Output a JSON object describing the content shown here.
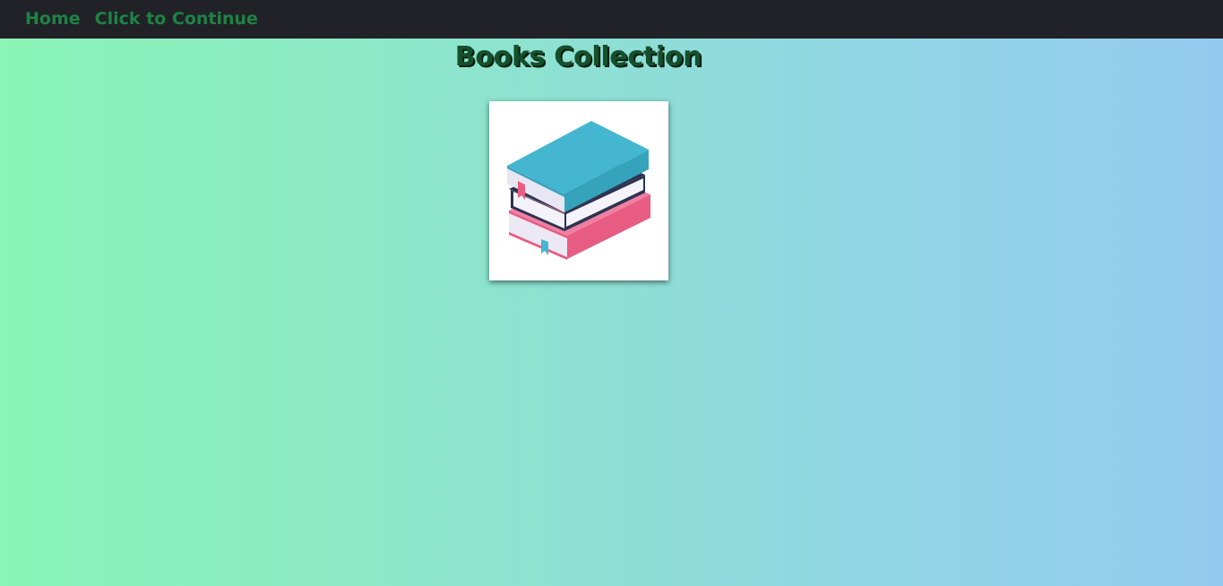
{
  "nav": {
    "home_label": "Home",
    "continue_label": "Click to Continue"
  },
  "main": {
    "title": "Books Collection"
  },
  "image": {
    "icon": "books-stack-icon"
  },
  "colors": {
    "nav_bg": "#202228",
    "nav_link": "#1f8244",
    "title": "#15502c",
    "book_teal": "#45b6d0",
    "book_pink": "#e85c83",
    "book_navy": "#2b3350"
  }
}
